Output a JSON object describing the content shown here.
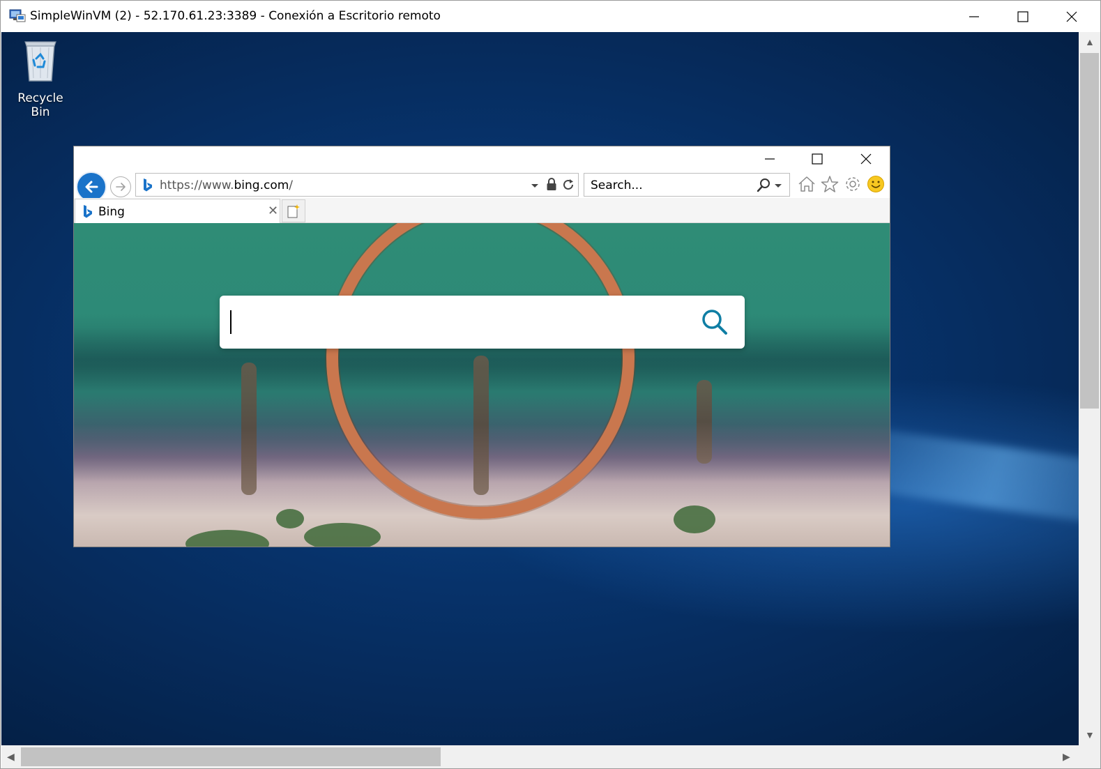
{
  "rdp": {
    "title": "SimpleWinVM (2) - 52.170.61.23:3389 - Conexión a Escritorio remoto",
    "minimize_icon": "minimize-icon",
    "maximize_icon": "maximize-icon",
    "close_icon": "close-icon"
  },
  "desktop": {
    "icons": [
      {
        "label": "Recycle Bin",
        "icon": "recycle-bin-icon"
      }
    ]
  },
  "browser": {
    "address": {
      "prefix": "https://www.",
      "domain": "bing.com",
      "suffix": "/"
    },
    "search_placeholder": "Search...",
    "tabs": [
      {
        "label": "Bing",
        "icon": "bing-favicon"
      }
    ],
    "toolbar_icons": [
      "home-icon",
      "favorites-star-icon",
      "tools-gear-icon",
      "feedback-smiley-icon"
    ]
  },
  "page": {
    "search_value": "",
    "search_icon": "magnifier-icon"
  },
  "colors": {
    "accent_blue": "#1a73c9",
    "bing_icon": "#0f7ea4",
    "desktop_blue": "#07326a"
  }
}
